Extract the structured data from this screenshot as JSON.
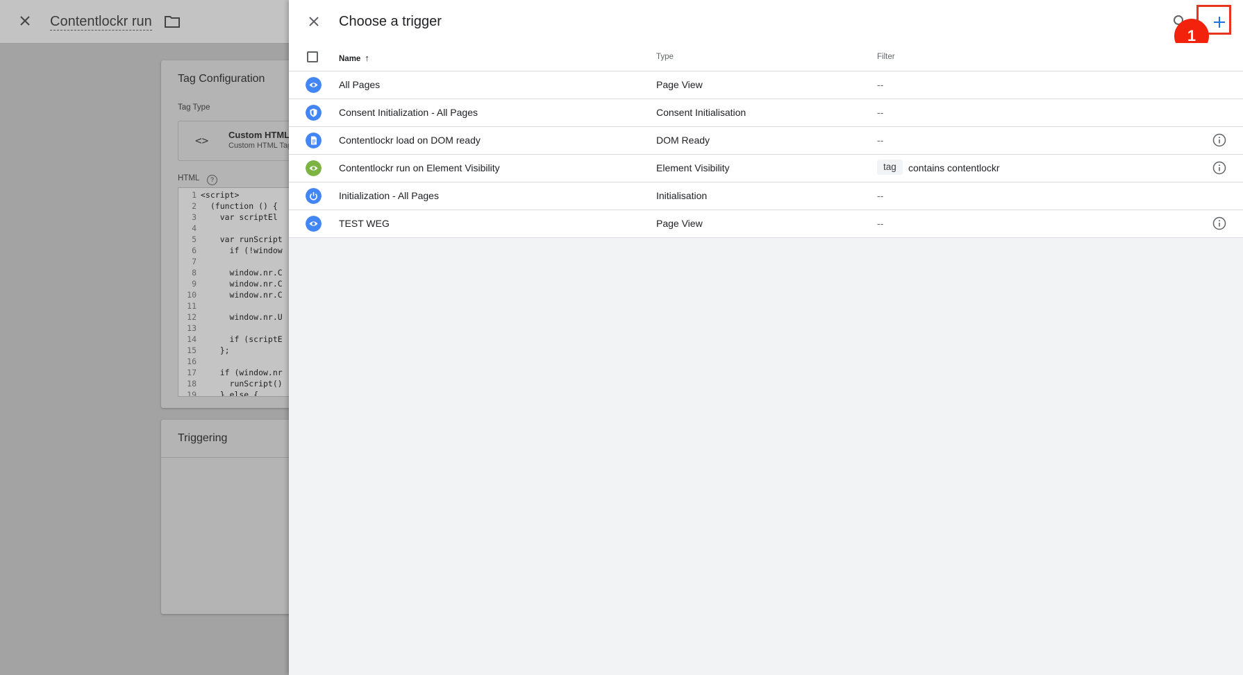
{
  "background": {
    "title": "Contentlockr run",
    "card_tag_configuration": {
      "heading": "Tag Configuration",
      "tag_type_label": "Tag Type",
      "type_name": "Custom HTML",
      "type_sub": "Custom HTML Tag",
      "html_label": "HTML",
      "code_lines": [
        "<script>",
        "  (function () {",
        "    var scriptEl",
        "",
        "    var runScript",
        "      if (!window",
        "",
        "      window.nr.C",
        "      window.nr.C",
        "      window.nr.C",
        "",
        "      window.nr.U",
        "",
        "      if (scriptE",
        "    };",
        "",
        "    if (window.nr",
        "      runScript()",
        "    } else {"
      ]
    },
    "card_triggering": {
      "heading": "Triggering"
    }
  },
  "drawer": {
    "title": "Choose a trigger",
    "columns": {
      "name": "Name",
      "type": "Type",
      "filter": "Filter"
    },
    "step_badge": "1",
    "rows": [
      {
        "name": "All Pages",
        "type": "Page View",
        "filter": "--",
        "icon": "eye-icon",
        "icon_color": "#4285f4",
        "info": false
      },
      {
        "name": "Consent Initialization - All Pages",
        "type": "Consent Initialisation",
        "filter": "--",
        "icon": "shield-icon",
        "icon_color": "#4285f4",
        "info": false
      },
      {
        "name": "Contentlockr load on DOM ready",
        "type": "DOM Ready",
        "filter": "--",
        "icon": "document-icon",
        "icon_color": "#4285f4",
        "info": true
      },
      {
        "name": "Contentlockr run on Element Visibility",
        "type": "Element Visibility",
        "filter_chip": "tag",
        "filter": "contains contentlockr",
        "icon": "eye-icon",
        "icon_color": "#7cb342",
        "info": true
      },
      {
        "name": "Initialization - All Pages",
        "type": "Initialisation",
        "filter": "--",
        "icon": "power-icon",
        "icon_color": "#4285f4",
        "info": false
      },
      {
        "name": "TEST WEG",
        "type": "Page View",
        "filter": "--",
        "icon": "eye-icon",
        "icon_color": "#4285f4",
        "info": true
      }
    ]
  },
  "colors": {
    "accent": "#1a73e8",
    "highlight": "#e8331f",
    "badge": "#f2220c"
  }
}
